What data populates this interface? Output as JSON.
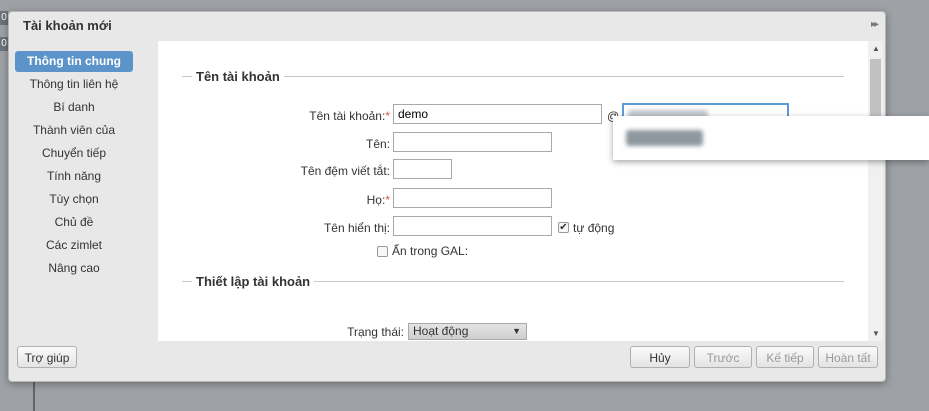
{
  "background_tabs": [
    "0",
    "0"
  ],
  "dialog": {
    "title": "Tài khoản mới",
    "expand_icon": "double-chevron-right-icon"
  },
  "sidebar": {
    "items": [
      {
        "label": "Thông tin chung",
        "active": true
      },
      {
        "label": "Thông tin liên hệ"
      },
      {
        "label": "Bí danh"
      },
      {
        "label": "Thành viên của"
      },
      {
        "label": "Chuyển tiếp"
      },
      {
        "label": "Tính năng"
      },
      {
        "label": "Tùy chọn"
      },
      {
        "label": "Chủ đề"
      },
      {
        "label": "Các zimlet"
      },
      {
        "label": "Nâng cao"
      }
    ]
  },
  "account_name_section": {
    "title": "Tên tài khoản",
    "account_label": "Tên tài khoản:",
    "account_value": "demo",
    "at_sign": "@",
    "first_name_label": "Tên:",
    "first_name_value": "",
    "initials_label": "Tên đệm viết tắt:",
    "initials_value": "",
    "last_name_label": "Họ:",
    "last_name_value": "",
    "display_name_label": "Tên hiển thị:",
    "display_name_value": "",
    "auto_label": "tự động",
    "auto_checked": true,
    "hide_gal_label": "Ẩn trong GAL:",
    "hide_gal_checked": false
  },
  "account_settings_section": {
    "title": "Thiết lập tài khoản",
    "status_label": "Trạng thái:",
    "status_value": "Hoạt động"
  },
  "footer": {
    "help_label": "Trợ giúp",
    "cancel_label": "Hủy",
    "previous_label": "Trước",
    "next_label": "Kế tiếp",
    "finish_label": "Hoàn tất"
  },
  "colors": {
    "accent": "#5c93c9",
    "required": "#d9534f",
    "dialog_bg": "#e8e8e8"
  }
}
